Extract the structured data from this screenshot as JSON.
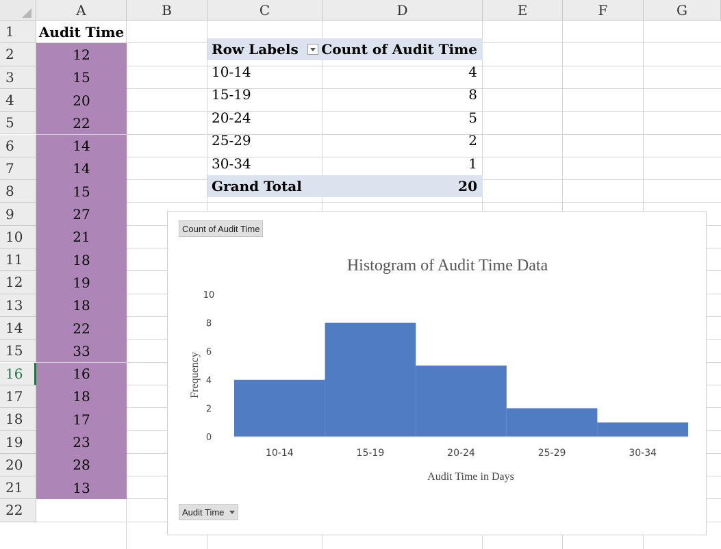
{
  "column_headers": [
    "A",
    "B",
    "C",
    "D",
    "E",
    "F",
    "G"
  ],
  "row_headers": [
    "1",
    "2",
    "3",
    "4",
    "5",
    "6",
    "7",
    "8",
    "9",
    "10",
    "11",
    "12",
    "13",
    "14",
    "15",
    "16",
    "17",
    "18",
    "19",
    "20",
    "21",
    "22"
  ],
  "active_row": "16",
  "column_a": {
    "header": "Audit Time",
    "values": [
      "12",
      "15",
      "20",
      "22",
      "14",
      "14",
      "15",
      "27",
      "21",
      "18",
      "19",
      "18",
      "22",
      "33",
      "16",
      "18",
      "17",
      "23",
      "28",
      "13"
    ]
  },
  "pivot": {
    "row_labels_header": "Row Labels",
    "count_header": "Count of Audit Time",
    "rows": [
      {
        "label": "10-14",
        "count": "4"
      },
      {
        "label": "15-19",
        "count": "8"
      },
      {
        "label": "20-24",
        "count": "5"
      },
      {
        "label": "25-29",
        "count": "2"
      },
      {
        "label": "30-34",
        "count": "1"
      }
    ],
    "grand_total_label": "Grand Total",
    "grand_total_value": "20"
  },
  "chart_buttons": {
    "value_field": "Count of Audit Time",
    "axis_field": "Audit Time"
  },
  "colors": {
    "column_a_fill": "#ad85b6",
    "pivot_header_fill": "#dbe4ee",
    "bar_fill": "#4f7cc3",
    "active_row_accent": "#217346"
  },
  "chart_data": {
    "type": "bar",
    "title": "Histogram of Audit Time Data",
    "xlabel": "Audit Time in Days",
    "ylabel": "Frequency",
    "categories": [
      "10-14",
      "15-19",
      "20-24",
      "25-29",
      "30-34"
    ],
    "values": [
      4,
      8,
      5,
      2,
      1
    ],
    "ylim": [
      0,
      10
    ],
    "yticks": [
      0,
      2,
      4,
      6,
      8,
      10
    ],
    "bar_gap": 0,
    "grid": false,
    "legend": "none"
  }
}
